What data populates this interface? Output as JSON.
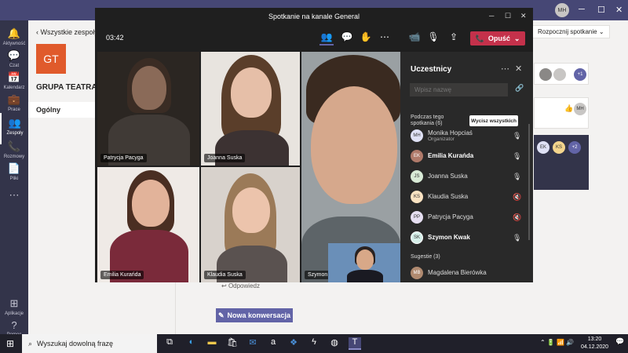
{
  "titlebar": {
    "avatar": "MH"
  },
  "rail": [
    {
      "label": "Aktywność",
      "icon": "bell-icon"
    },
    {
      "label": "Czat",
      "icon": "chat-icon"
    },
    {
      "label": "Kalendarz",
      "icon": "calendar-icon"
    },
    {
      "label": "Prace",
      "icon": "assignments-icon"
    },
    {
      "label": "Zespoły",
      "icon": "teams-icon"
    },
    {
      "label": "Rozmowy",
      "icon": "phone-icon"
    },
    {
      "label": "Pliki",
      "icon": "files-icon"
    },
    {
      "label": "Aplikacje",
      "icon": "apps-icon"
    },
    {
      "label": "Pomoc",
      "icon": "help-icon"
    }
  ],
  "team": {
    "back": "Wszystkie zespoły",
    "logo": "GT",
    "name": "GRUPA TEATRAL",
    "channel": "Ogólny"
  },
  "content": {
    "start_meeting": "Rozpocznij spotkanie",
    "reply": "Odpowiedz",
    "new_conversation": "Nowa konwersacja",
    "avatars": [
      "EK",
      "KS",
      "+2"
    ],
    "badge": "+1",
    "avatar_mh": "MH"
  },
  "meeting": {
    "title": "Spotkanie na kanale General",
    "time": "03:42",
    "leave": "Opuść",
    "tiles": [
      "Patrycja Pacyga",
      "Joanna Suska",
      "Szymon Kwak",
      "Emilia Kurańda",
      "Klaudia Suska",
      "Szymon K"
    ]
  },
  "participants": {
    "title": "Uczestnicy",
    "search_placeholder": "Wpisz nazwę",
    "in_meeting": "Podczas tego spotkania (6)",
    "mute_all": "Wycisz wszystkich",
    "suggestions": "Sugestie (3)",
    "list": [
      {
        "initials": "MH",
        "name": "Monika Hopciaś",
        "role": "Organizator",
        "mic": "🎙"
      },
      {
        "initials": "EK",
        "name": "Emilia Kurańda",
        "role": "",
        "mic": "🎙"
      },
      {
        "initials": "JS",
        "name": "Joanna Suska",
        "role": "",
        "mic": "🎙"
      },
      {
        "initials": "KS",
        "name": "Klaudia Suska",
        "role": "",
        "mic": "🔇"
      },
      {
        "initials": "PP",
        "name": "Patrycja Pacyga",
        "role": "",
        "mic": "🔇"
      },
      {
        "initials": "SK",
        "name": "Szymon Kwak",
        "role": "",
        "mic": "🎙"
      }
    ],
    "suggested": [
      {
        "initials": "MB",
        "name": "Magdalena Bierówka"
      }
    ]
  },
  "taskbar": {
    "search": "Wyszukaj dowolną frazę",
    "time": "13:20",
    "date": "04.12.2020"
  }
}
